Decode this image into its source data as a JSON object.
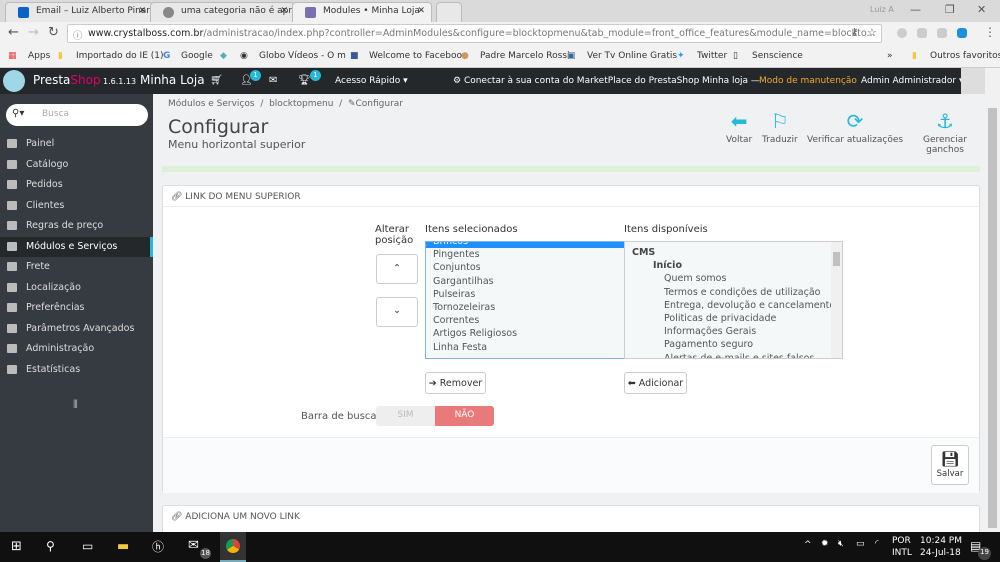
{
  "browser": {
    "tabs": [
      {
        "title": "Email – Luiz Alberto Pinar"
      },
      {
        "title": "uma categoria não é apre"
      },
      {
        "title": "Modules • Minha Loja"
      }
    ],
    "user": "Luiz A",
    "url_host": "www.crystalboss.com.br",
    "url_path": "/administracao/index.php?controller=AdminModules&configure=blocktopmenu&tab_module=front_office_features&module_name=blockto...",
    "bookmarks": [
      "Apps",
      "Importado do IE (1)",
      "Google",
      "Globo Vídeos - O m",
      "Welcome to Faceboo",
      "Padre Marcelo Rossi",
      "Ver Tv Online Gratis",
      "Twitter",
      "Senscience"
    ],
    "other_bookmarks": "Outros favoritos"
  },
  "header": {
    "brand1": "Presta",
    "brand2": "Shop",
    "version": "1.6.1.13",
    "shop": "Minha Loja",
    "customers_badge": "1",
    "trophy_badge": "1",
    "quick_access": "Acesso Rápido ▾",
    "marketplace": "Conectar à sua conta do MarketPlace do PrestaShop",
    "shop_status": "Minha loja —",
    "maintenance": "Modo de manutenção",
    "admin": "Admin Administrador ▾"
  },
  "sidebar": {
    "search_placeholder": "Busca",
    "items": [
      "Painel",
      "Catálogo",
      "Pedidos",
      "Clientes",
      "Regras de preço",
      "Módulos e Serviços",
      "Frete",
      "Localização",
      "Preferências",
      "Parâmetros Avançados",
      "Administração",
      "Estatísticas"
    ]
  },
  "page": {
    "breadcrumb": [
      "Módulos e Serviços",
      "/",
      "blocktopmenu",
      "/",
      "Configurar"
    ],
    "title": "Configurar",
    "subtitle": "Menu horizontal superior",
    "toolbar": [
      "Voltar",
      "Traduzir",
      "Verificar atualizações",
      "Gerenciar ganchos"
    ]
  },
  "panel": {
    "heading": "Link do menu superior",
    "change_position": "Alterar posição",
    "selected_label": "Itens selecionados",
    "available_label": "Itens disponíveis",
    "selected_items": [
      "Brincos",
      "Pingentes",
      "Conjuntos",
      "Gargantilhas",
      "Pulseiras",
      "Tornozeleiras",
      "Correntes",
      "Artigos Religiosos",
      "Linha Festa"
    ],
    "available_items": [
      "CMS",
      "Início",
      "Quem somos",
      "Termos e condições de utilização",
      "Entrega, devolução e cancelamento",
      "Politicas de privacidade",
      "Informações Gerais",
      "Pagamento seguro",
      "Alertas de e-mails e sites falsos"
    ],
    "remove": "Remover",
    "add": "Adicionar",
    "search_bar_label": "Barra de busca",
    "yes": "SIM",
    "no": "NÃO",
    "save": "Salvar"
  },
  "panel2": {
    "heading": "Adiciona um novo link"
  },
  "taskbar": {
    "lang1": "POR",
    "lang2": "INTL",
    "time": "10:24 PM",
    "date": "24-Jul-18",
    "notif": "19",
    "mail_badge": "18"
  }
}
